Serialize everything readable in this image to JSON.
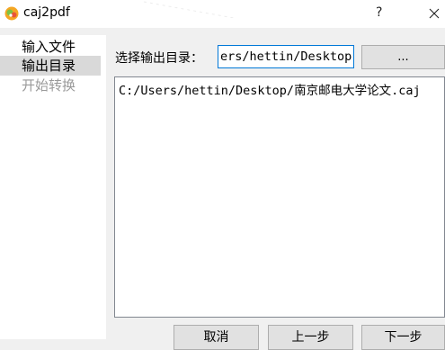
{
  "window": {
    "title": "caj2pdf",
    "help_label": "?",
    "close_icon": "close-icon",
    "app_icon": "caj2pdf-app-icon"
  },
  "sidebar": {
    "items": [
      {
        "label": "输入文件",
        "state": "normal"
      },
      {
        "label": "输出目录",
        "state": "selected"
      },
      {
        "label": "开始转换",
        "state": "disabled"
      }
    ]
  },
  "output": {
    "label": "选择输出目录：",
    "path_value": "ers/hettin/Desktop",
    "browse_label": "..."
  },
  "files": {
    "items": [
      "C:/Users/hettin/Desktop/南京邮电大学论文.caj"
    ]
  },
  "buttons": {
    "cancel": "取消",
    "prev": "上一步",
    "next": "下一步"
  },
  "colors": {
    "focus_border": "#0078d7",
    "selected_bg": "#d9d9d9",
    "disabled_text": "#9a9a9a",
    "window_bg": "#f0f0f0"
  }
}
